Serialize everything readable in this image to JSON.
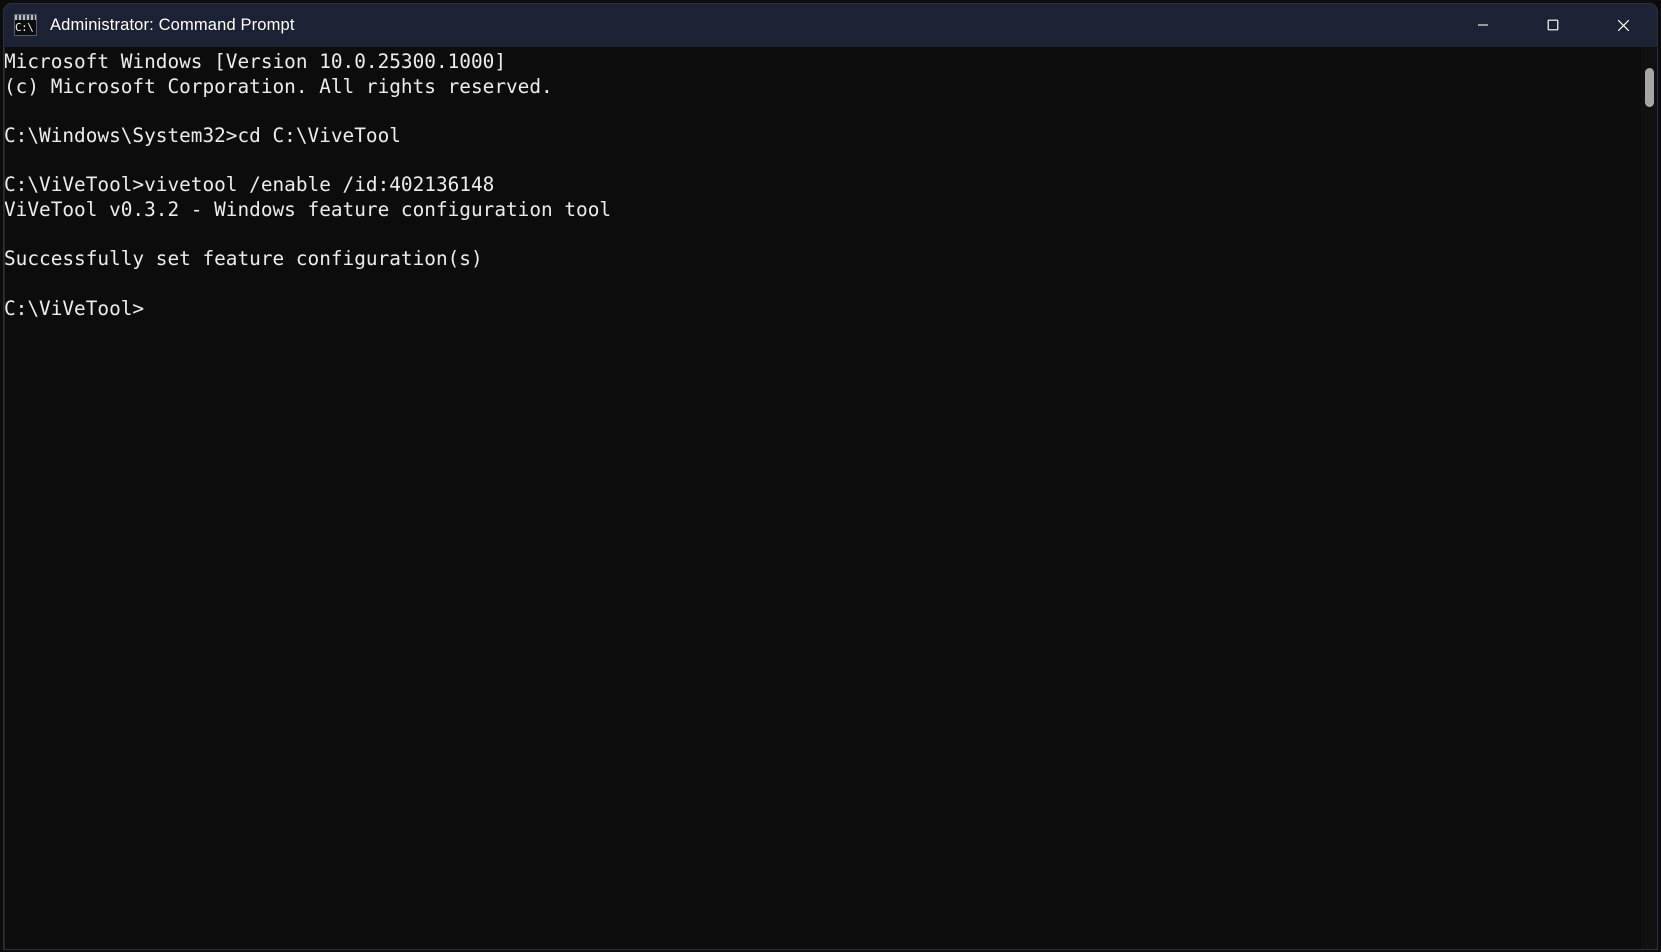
{
  "window": {
    "title": "Administrator: Command Prompt",
    "icon": "cmd-prompt-icon",
    "icon_glyph": "C:\\.",
    "titlebar_color": "#1c2134",
    "background_color": "#0c0c0c",
    "text_color": "#ececec"
  },
  "window_controls": {
    "minimize": "Minimize",
    "maximize": "Maximize",
    "close": "Close"
  },
  "terminal": {
    "content": "Microsoft Windows [Version 10.0.25300.1000]\n(c) Microsoft Corporation. All rights reserved.\n\nC:\\Windows\\System32>cd C:\\ViveTool\n\nC:\\ViVeTool>vivetool /enable /id:402136148\nViVeTool v0.3.2 - Windows feature configuration tool\n\nSuccessfully set feature configuration(s)\n\nC:\\ViVeTool>",
    "lines": [
      "Microsoft Windows [Version 10.0.25300.1000]",
      "(c) Microsoft Corporation. All rights reserved.",
      "",
      "C:\\Windows\\System32>cd C:\\ViveTool",
      "",
      "C:\\ViVeTool>vivetool /enable /id:402136148",
      "ViVeTool v0.3.2 - Windows feature configuration tool",
      "",
      "Successfully set feature configuration(s)",
      "",
      "C:\\ViVeTool>"
    ],
    "current_prompt": "C:\\ViVeTool>",
    "commands_entered": [
      "cd C:\\ViveTool",
      "vivetool /enable /id:402136148"
    ],
    "feature_id": "402136148",
    "vivetool_version": "v0.3.2",
    "windows_version": "10.0.25300.1000",
    "status_message": "Successfully set feature configuration(s)"
  },
  "scrollbar": {
    "label": "vertical-scrollbar"
  }
}
